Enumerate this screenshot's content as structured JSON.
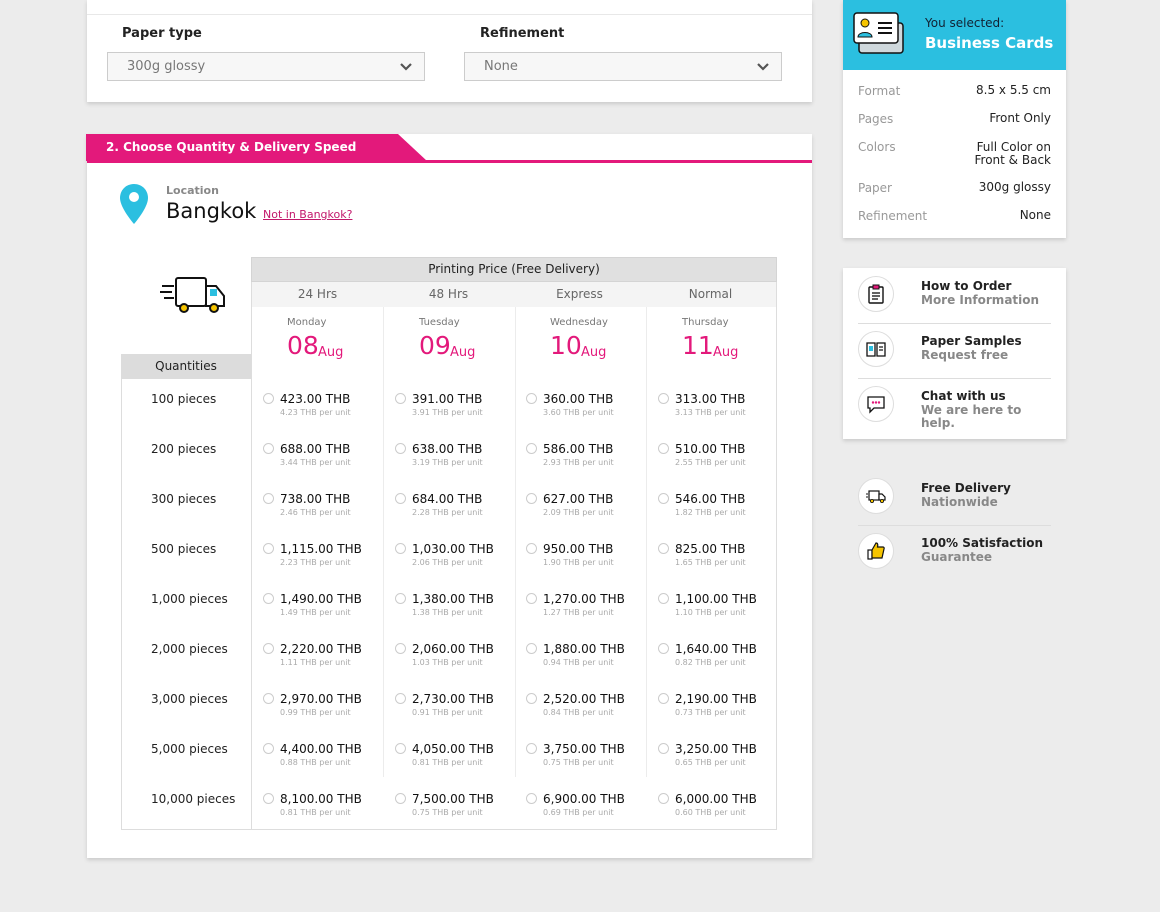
{
  "paper": {
    "paper_type_label": "Paper type",
    "paper_type_value": "300g glossy",
    "refinement_label": "Refinement",
    "refinement_value": "None"
  },
  "section": {
    "title": "2. Choose Quantity & Delivery Speed",
    "color": "#e3197b"
  },
  "location": {
    "label": "Location",
    "city": "Bangkok",
    "change_link": "Not in Bangkok?"
  },
  "table": {
    "header": "Printing Price (Free Delivery)",
    "quantities_label": "Quantities",
    "speeds": [
      {
        "label": "24 Hrs",
        "weekday": "Monday",
        "day": "08",
        "month": "Aug"
      },
      {
        "label": "48 Hrs",
        "weekday": "Tuesday",
        "day": "09",
        "month": "Aug"
      },
      {
        "label": "Express",
        "weekday": "Wednesday",
        "day": "10",
        "month": "Aug"
      },
      {
        "label": "Normal",
        "weekday": "Thursday",
        "day": "11",
        "month": "Aug"
      }
    ],
    "rows": [
      {
        "qty": "100 pieces",
        "prices": [
          {
            "p": "423.00 THB",
            "u": "4.23 THB per unit"
          },
          {
            "p": "391.00 THB",
            "u": "3.91 THB per unit"
          },
          {
            "p": "360.00 THB",
            "u": "3.60 THB per unit"
          },
          {
            "p": "313.00 THB",
            "u": "3.13 THB per unit"
          }
        ]
      },
      {
        "qty": "200 pieces",
        "prices": [
          {
            "p": "688.00 THB",
            "u": "3.44 THB per unit"
          },
          {
            "p": "638.00 THB",
            "u": "3.19 THB per unit"
          },
          {
            "p": "586.00 THB",
            "u": "2.93 THB per unit"
          },
          {
            "p": "510.00 THB",
            "u": "2.55 THB per unit"
          }
        ]
      },
      {
        "qty": "300 pieces",
        "prices": [
          {
            "p": "738.00 THB",
            "u": "2.46 THB per unit"
          },
          {
            "p": "684.00 THB",
            "u": "2.28 THB per unit"
          },
          {
            "p": "627.00 THB",
            "u": "2.09 THB per unit"
          },
          {
            "p": "546.00 THB",
            "u": "1.82 THB per unit"
          }
        ]
      },
      {
        "qty": "500 pieces",
        "prices": [
          {
            "p": "1,115.00 THB",
            "u": "2.23 THB per unit"
          },
          {
            "p": "1,030.00 THB",
            "u": "2.06 THB per unit"
          },
          {
            "p": "950.00 THB",
            "u": "1.90 THB per unit"
          },
          {
            "p": "825.00 THB",
            "u": "1.65 THB per unit"
          }
        ]
      },
      {
        "qty": "1,000 pieces",
        "prices": [
          {
            "p": "1,490.00 THB",
            "u": "1.49 THB per unit"
          },
          {
            "p": "1,380.00 THB",
            "u": "1.38 THB per unit"
          },
          {
            "p": "1,270.00 THB",
            "u": "1.27 THB per unit"
          },
          {
            "p": "1,100.00 THB",
            "u": "1.10 THB per unit"
          }
        ]
      },
      {
        "qty": "2,000 pieces",
        "prices": [
          {
            "p": "2,220.00 THB",
            "u": "1.11 THB per unit"
          },
          {
            "p": "2,060.00 THB",
            "u": "1.03 THB per unit"
          },
          {
            "p": "1,880.00 THB",
            "u": "0.94 THB per unit"
          },
          {
            "p": "1,640.00 THB",
            "u": "0.82 THB per unit"
          }
        ]
      },
      {
        "qty": "3,000 pieces",
        "prices": [
          {
            "p": "2,970.00 THB",
            "u": "0.99 THB per unit"
          },
          {
            "p": "2,730.00 THB",
            "u": "0.91 THB per unit"
          },
          {
            "p": "2,520.00 THB",
            "u": "0.84 THB per unit"
          },
          {
            "p": "2,190.00 THB",
            "u": "0.73 THB per unit"
          }
        ]
      },
      {
        "qty": "5,000 pieces",
        "prices": [
          {
            "p": "4,400.00 THB",
            "u": "0.88 THB per unit"
          },
          {
            "p": "4,050.00 THB",
            "u": "0.81 THB per unit"
          },
          {
            "p": "3,750.00 THB",
            "u": "0.75 THB per unit"
          },
          {
            "p": "3,250.00 THB",
            "u": "0.65 THB per unit"
          }
        ]
      },
      {
        "qty": "10,000 pieces",
        "prices": [
          {
            "p": "8,100.00 THB",
            "u": "0.81 THB per unit"
          },
          {
            "p": "7,500.00 THB",
            "u": "0.75 THB per unit"
          },
          {
            "p": "6,900.00 THB",
            "u": "0.69 THB per unit"
          },
          {
            "p": "6,000.00 THB",
            "u": "0.60 THB per unit"
          }
        ]
      }
    ]
  },
  "summary": {
    "you_selected": "You selected:",
    "product": "Business Cards",
    "specs": [
      {
        "k": "Format",
        "v": "8.5 x 5.5 cm"
      },
      {
        "k": "Pages",
        "v": "Front Only"
      },
      {
        "k": "Colors",
        "v": "Full Color on\nFront & Back"
      },
      {
        "k": "Paper",
        "v": "300g glossy"
      },
      {
        "k": "Refinement",
        "v": "None"
      }
    ],
    "accent": "#2bbfe0"
  },
  "help": [
    {
      "title": "How to Order",
      "sub": "More Information",
      "icon": "clipboard-icon"
    },
    {
      "title": "Paper Samples",
      "sub": "Request free",
      "icon": "book-icon"
    },
    {
      "title": "Chat with us",
      "sub": "We are here to help.",
      "icon": "chat-icon"
    }
  ],
  "features": [
    {
      "title": "Free Delivery",
      "sub": "Nationwide",
      "icon": "truck-icon"
    },
    {
      "title": "100% Satisfaction",
      "sub": "Guarantee",
      "icon": "thumbs-up-icon"
    }
  ]
}
